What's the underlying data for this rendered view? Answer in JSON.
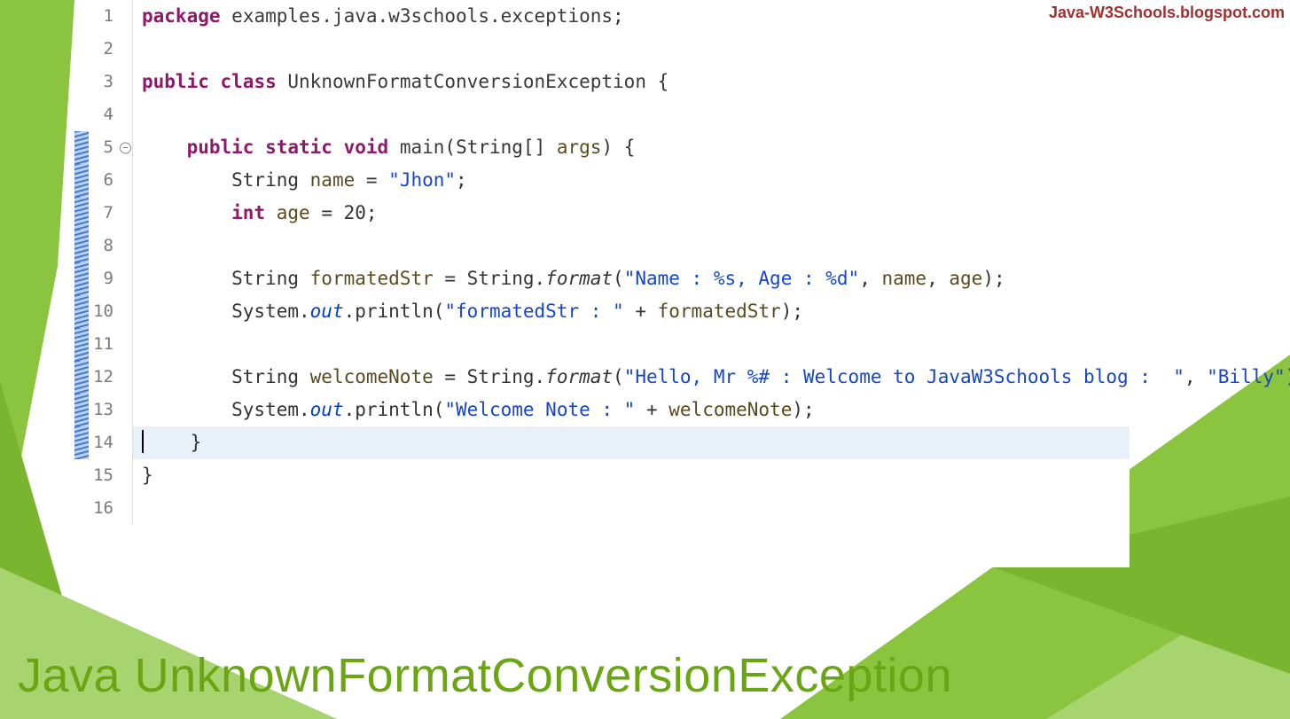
{
  "watermark": "Java-W3Schools.blogspot.com",
  "footer_title": "Java UnknownFormatConversionException",
  "code": {
    "lines": [
      {
        "n": "1",
        "marker": false,
        "fold": false,
        "hl": false,
        "tokens": [
          {
            "c": "kw",
            "t": "package"
          },
          {
            "c": "pun",
            "t": " "
          },
          {
            "c": "pkg",
            "t": "examples.java.w3schools.exceptions"
          },
          {
            "c": "pun",
            "t": ";"
          }
        ]
      },
      {
        "n": "2",
        "marker": false,
        "fold": false,
        "hl": false,
        "tokens": []
      },
      {
        "n": "3",
        "marker": false,
        "fold": false,
        "hl": false,
        "tokens": [
          {
            "c": "kw",
            "t": "public"
          },
          {
            "c": "pun",
            "t": " "
          },
          {
            "c": "kw",
            "t": "class"
          },
          {
            "c": "pun",
            "t": " "
          },
          {
            "c": "typ",
            "t": "UnknownFormatConversionException"
          },
          {
            "c": "pun",
            "t": " {"
          }
        ]
      },
      {
        "n": "4",
        "marker": false,
        "fold": false,
        "hl": false,
        "tokens": []
      },
      {
        "n": "5",
        "marker": true,
        "fold": true,
        "hl": false,
        "tokens": [
          {
            "c": "pun",
            "t": "    "
          },
          {
            "c": "kw",
            "t": "public"
          },
          {
            "c": "pun",
            "t": " "
          },
          {
            "c": "kw",
            "t": "static"
          },
          {
            "c": "pun",
            "t": " "
          },
          {
            "c": "kw",
            "t": "void"
          },
          {
            "c": "pun",
            "t": " "
          },
          {
            "c": "typ",
            "t": "main"
          },
          {
            "c": "pun",
            "t": "(String[] "
          },
          {
            "c": "ident",
            "t": "args"
          },
          {
            "c": "pun",
            "t": ") {"
          }
        ]
      },
      {
        "n": "6",
        "marker": true,
        "fold": false,
        "hl": false,
        "tokens": [
          {
            "c": "pun",
            "t": "        String "
          },
          {
            "c": "ident",
            "t": "name"
          },
          {
            "c": "pun",
            "t": " = "
          },
          {
            "c": "str",
            "t": "\"Jhon\""
          },
          {
            "c": "pun",
            "t": ";"
          }
        ]
      },
      {
        "n": "7",
        "marker": true,
        "fold": false,
        "hl": false,
        "tokens": [
          {
            "c": "pun",
            "t": "        "
          },
          {
            "c": "kw",
            "t": "int"
          },
          {
            "c": "pun",
            "t": " "
          },
          {
            "c": "ident",
            "t": "age"
          },
          {
            "c": "pun",
            "t": " = 20;"
          }
        ]
      },
      {
        "n": "8",
        "marker": true,
        "fold": false,
        "hl": false,
        "tokens": []
      },
      {
        "n": "9",
        "marker": true,
        "fold": false,
        "hl": false,
        "tokens": [
          {
            "c": "pun",
            "t": "        String "
          },
          {
            "c": "ident",
            "t": "formatedStr"
          },
          {
            "c": "pun",
            "t": " = String."
          },
          {
            "c": "mth",
            "t": "format"
          },
          {
            "c": "pun",
            "t": "("
          },
          {
            "c": "str",
            "t": "\"Name : %s, Age : %d\""
          },
          {
            "c": "pun",
            "t": ", "
          },
          {
            "c": "ident",
            "t": "name"
          },
          {
            "c": "pun",
            "t": ", "
          },
          {
            "c": "ident",
            "t": "age"
          },
          {
            "c": "pun",
            "t": ");"
          }
        ]
      },
      {
        "n": "10",
        "marker": true,
        "fold": false,
        "hl": false,
        "tokens": [
          {
            "c": "pun",
            "t": "        System."
          },
          {
            "c": "out",
            "t": "out"
          },
          {
            "c": "pun",
            "t": ".println("
          },
          {
            "c": "str",
            "t": "\"formatedStr : \""
          },
          {
            "c": "pun",
            "t": " + "
          },
          {
            "c": "ident",
            "t": "formatedStr"
          },
          {
            "c": "pun",
            "t": ");"
          }
        ]
      },
      {
        "n": "11",
        "marker": true,
        "fold": false,
        "hl": false,
        "tokens": []
      },
      {
        "n": "12",
        "marker": true,
        "fold": false,
        "hl": false,
        "tokens": [
          {
            "c": "pun",
            "t": "        String "
          },
          {
            "c": "ident",
            "t": "welcomeNote"
          },
          {
            "c": "pun",
            "t": " = String."
          },
          {
            "c": "mth",
            "t": "format"
          },
          {
            "c": "pun",
            "t": "("
          },
          {
            "c": "str",
            "t": "\"Hello, Mr %# : Welcome to JavaW3Schools blog :  \""
          },
          {
            "c": "pun",
            "t": ", "
          },
          {
            "c": "str",
            "t": "\"Billy\""
          },
          {
            "c": "pun",
            "t": ");"
          }
        ]
      },
      {
        "n": "13",
        "marker": true,
        "fold": false,
        "hl": false,
        "tokens": [
          {
            "c": "pun",
            "t": "        System."
          },
          {
            "c": "out",
            "t": "out"
          },
          {
            "c": "pun",
            "t": ".println("
          },
          {
            "c": "str",
            "t": "\"Welcome Note : \""
          },
          {
            "c": "pun",
            "t": " + "
          },
          {
            "c": "ident",
            "t": "welcomeNote"
          },
          {
            "c": "pun",
            "t": ");"
          }
        ]
      },
      {
        "n": "14",
        "marker": true,
        "fold": false,
        "hl": true,
        "cursor": true,
        "tokens": [
          {
            "c": "pun",
            "t": "    }"
          }
        ]
      },
      {
        "n": "15",
        "marker": false,
        "fold": false,
        "hl": false,
        "tokens": [
          {
            "c": "pun",
            "t": "}"
          }
        ]
      },
      {
        "n": "16",
        "marker": false,
        "fold": false,
        "hl": false,
        "tokens": []
      }
    ]
  }
}
